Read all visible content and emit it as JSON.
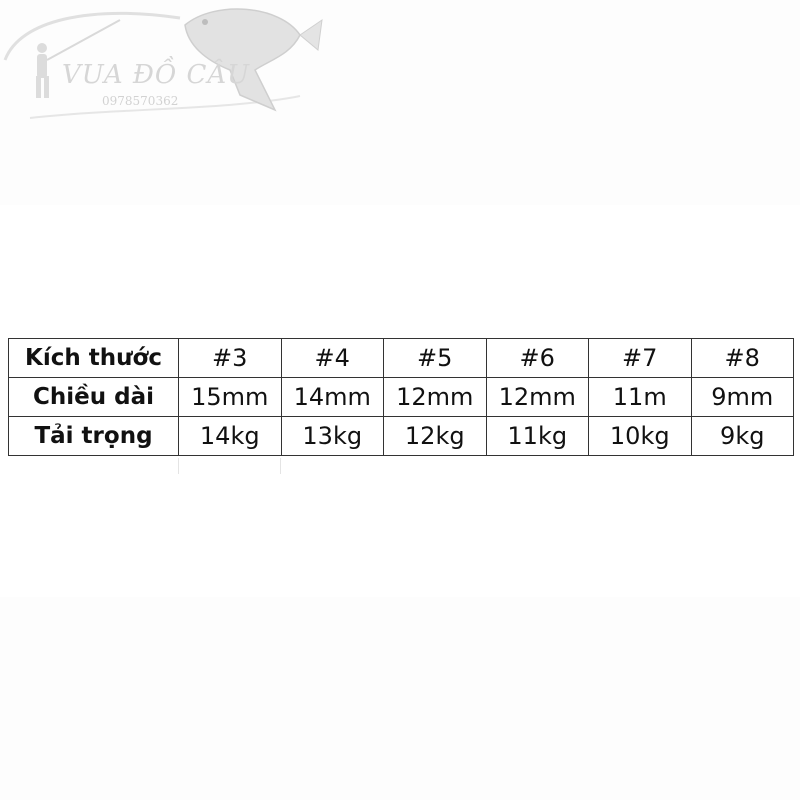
{
  "watermark": {
    "brand": "VUA ĐỒ CÂU",
    "phone": "0978570362"
  },
  "table": {
    "rows": [
      {
        "label": "Kích thước",
        "cells": [
          "#3",
          "#4",
          "#5",
          "#6",
          "#7",
          "#8"
        ]
      },
      {
        "label": "Chiều dài",
        "cells": [
          "15mm",
          "14mm",
          "12mm",
          "12mm",
          "11m",
          "9mm"
        ]
      },
      {
        "label": "Tải trọng",
        "cells": [
          "14kg",
          "13kg",
          "12kg",
          "11kg",
          "10kg",
          "9kg"
        ]
      }
    ]
  },
  "colors": {
    "border": "#333333",
    "text": "#111111",
    "watermark": "#d6d6d6"
  }
}
